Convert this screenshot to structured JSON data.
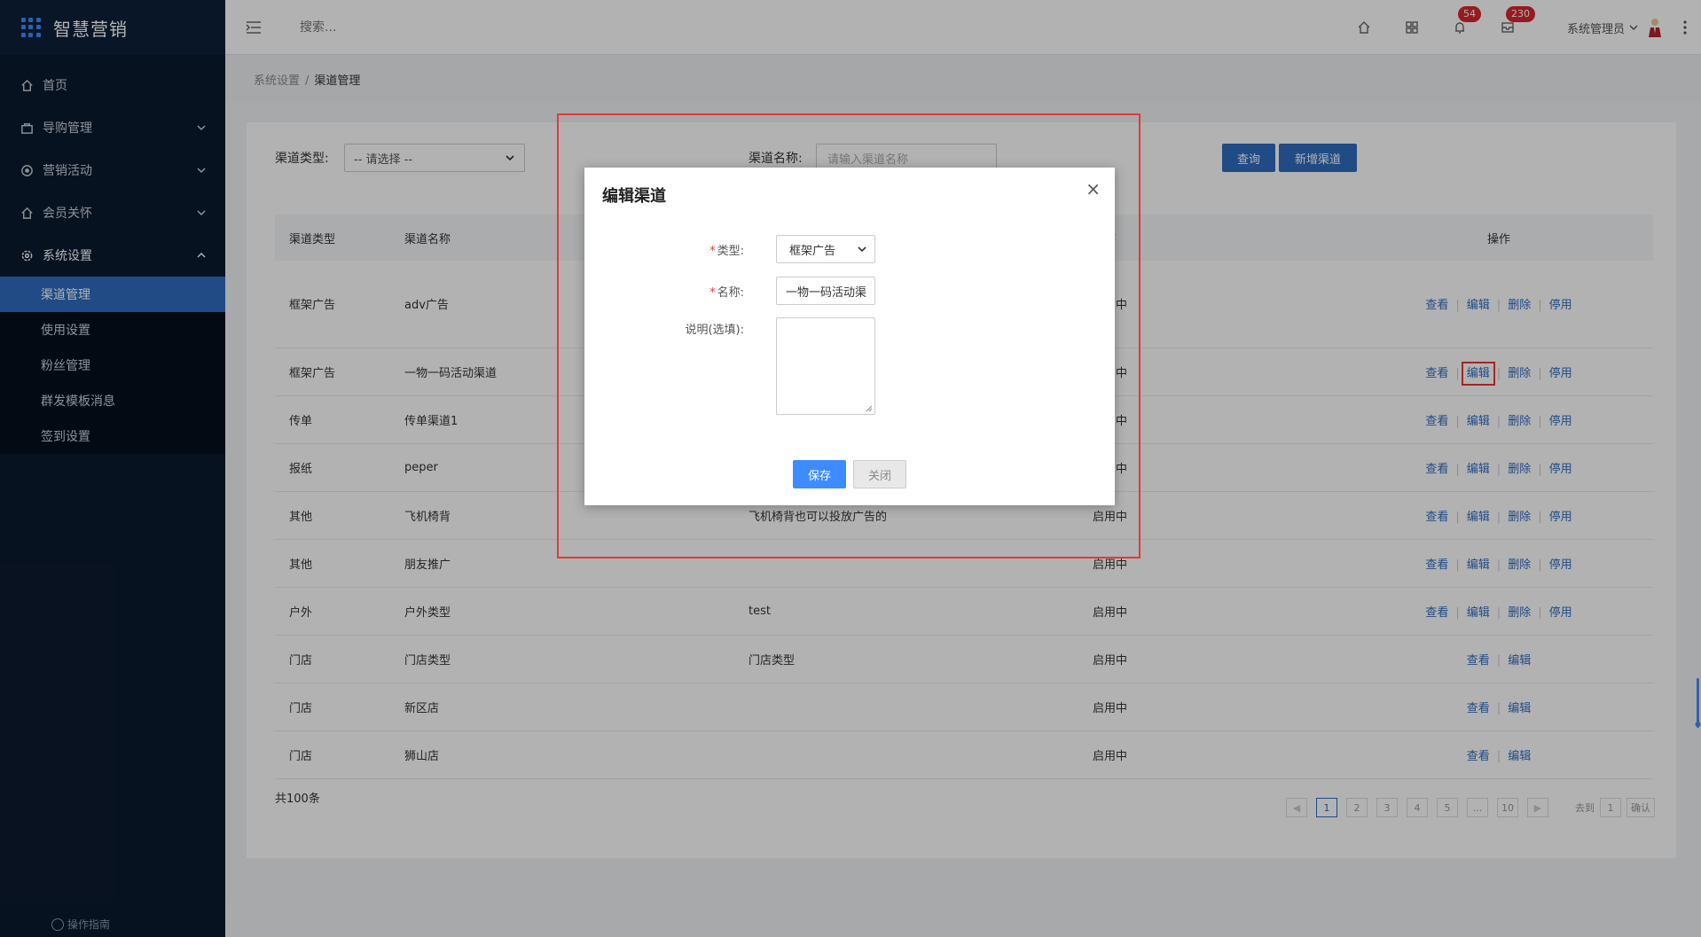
{
  "app": {
    "title": "智慧营销"
  },
  "sidebar": {
    "items": [
      {
        "label": "首页",
        "icon": "home-icon"
      },
      {
        "label": "导购管理",
        "icon": "bag-icon"
      },
      {
        "label": "营销活动",
        "icon": "target-icon"
      },
      {
        "label": "会员关怀",
        "icon": "house-icon"
      },
      {
        "label": "系统设置",
        "icon": "gear-icon"
      }
    ],
    "submenu": [
      {
        "label": "渠道管理",
        "active": true
      },
      {
        "label": "使用设置",
        "active": false
      },
      {
        "label": "粉丝管理",
        "active": false
      },
      {
        "label": "群发模板消息",
        "active": false
      },
      {
        "label": "签到设置",
        "active": false
      }
    ],
    "guide": "操作指南"
  },
  "topbar": {
    "search_placeholder": "搜索...",
    "notification_count": "54",
    "message_count": "230",
    "user_name": "系统管理员"
  },
  "breadcrumb": {
    "parent": "系统设置",
    "separator": "/",
    "current": "渠道管理"
  },
  "filters": {
    "type_label": "渠道类型:",
    "type_value": "-- 请选择 --",
    "name_label": "渠道名称:",
    "name_placeholder": "请输入渠道名称",
    "query_button": "查询",
    "add_button": "新增渠道"
  },
  "table": {
    "headers": [
      "渠道类型",
      "渠道名称",
      "",
      "状态",
      "操作"
    ],
    "rows": [
      {
        "type": "框架广告",
        "name": "adv广告",
        "desc": "",
        "status": "启用中",
        "ops": [
          "查看",
          "编辑",
          "删除",
          "停用"
        ]
      },
      {
        "type": "框架广告",
        "name": "一物一码活动渠道",
        "desc": "",
        "status": "启用中",
        "ops": [
          "查看",
          "编辑",
          "删除",
          "停用"
        ]
      },
      {
        "type": "传单",
        "name": "传单渠道1",
        "desc": "",
        "status": "启用中",
        "ops": [
          "查看",
          "编辑",
          "删除",
          "停用"
        ]
      },
      {
        "type": "报纸",
        "name": "peper",
        "desc": "",
        "status": "启用中",
        "ops": [
          "查看",
          "编辑",
          "删除",
          "停用"
        ]
      },
      {
        "type": "其他",
        "name": "飞机椅背",
        "desc": "飞机椅背也可以投放广告的",
        "status": "启用中",
        "ops": [
          "查看",
          "编辑",
          "删除",
          "停用"
        ]
      },
      {
        "type": "其他",
        "name": "朋友推广",
        "desc": "",
        "status": "启用中",
        "ops": [
          "查看",
          "编辑",
          "删除",
          "停用"
        ]
      },
      {
        "type": "户外",
        "name": "户外类型",
        "desc": "test",
        "status": "启用中",
        "ops": [
          "查看",
          "编辑",
          "删除",
          "停用"
        ]
      },
      {
        "type": "门店",
        "name": "门店类型",
        "desc": "门店类型",
        "status": "启用中",
        "ops": [
          "查看",
          "编辑"
        ]
      },
      {
        "type": "门店",
        "name": "新区店",
        "desc": "",
        "status": "启用中",
        "ops": [
          "查看",
          "编辑"
        ]
      },
      {
        "type": "门店",
        "name": "狮山店",
        "desc": "",
        "status": "启用中",
        "ops": [
          "查看",
          "编辑"
        ]
      }
    ]
  },
  "pagination": {
    "total": "共100条",
    "pages": [
      "1",
      "2",
      "3",
      "4",
      "5",
      "...",
      "10"
    ],
    "current": "1",
    "goto_label": "去到",
    "goto_value": "1",
    "confirm": "确认"
  },
  "modal": {
    "title": "编辑渠道",
    "close": "×",
    "required_mark": "*",
    "type_label": "类型:",
    "type_value": "框架广告",
    "name_label": "名称:",
    "name_value": "一物一码活动渠",
    "desc_label": "说明(选填):",
    "save": "保存",
    "close_button": "关闭"
  },
  "colors": {
    "sidebar_bg": "#0b1a2f",
    "accent": "#2f6cbf",
    "highlight_frame": "#e53935",
    "badge": "#d9262c"
  }
}
